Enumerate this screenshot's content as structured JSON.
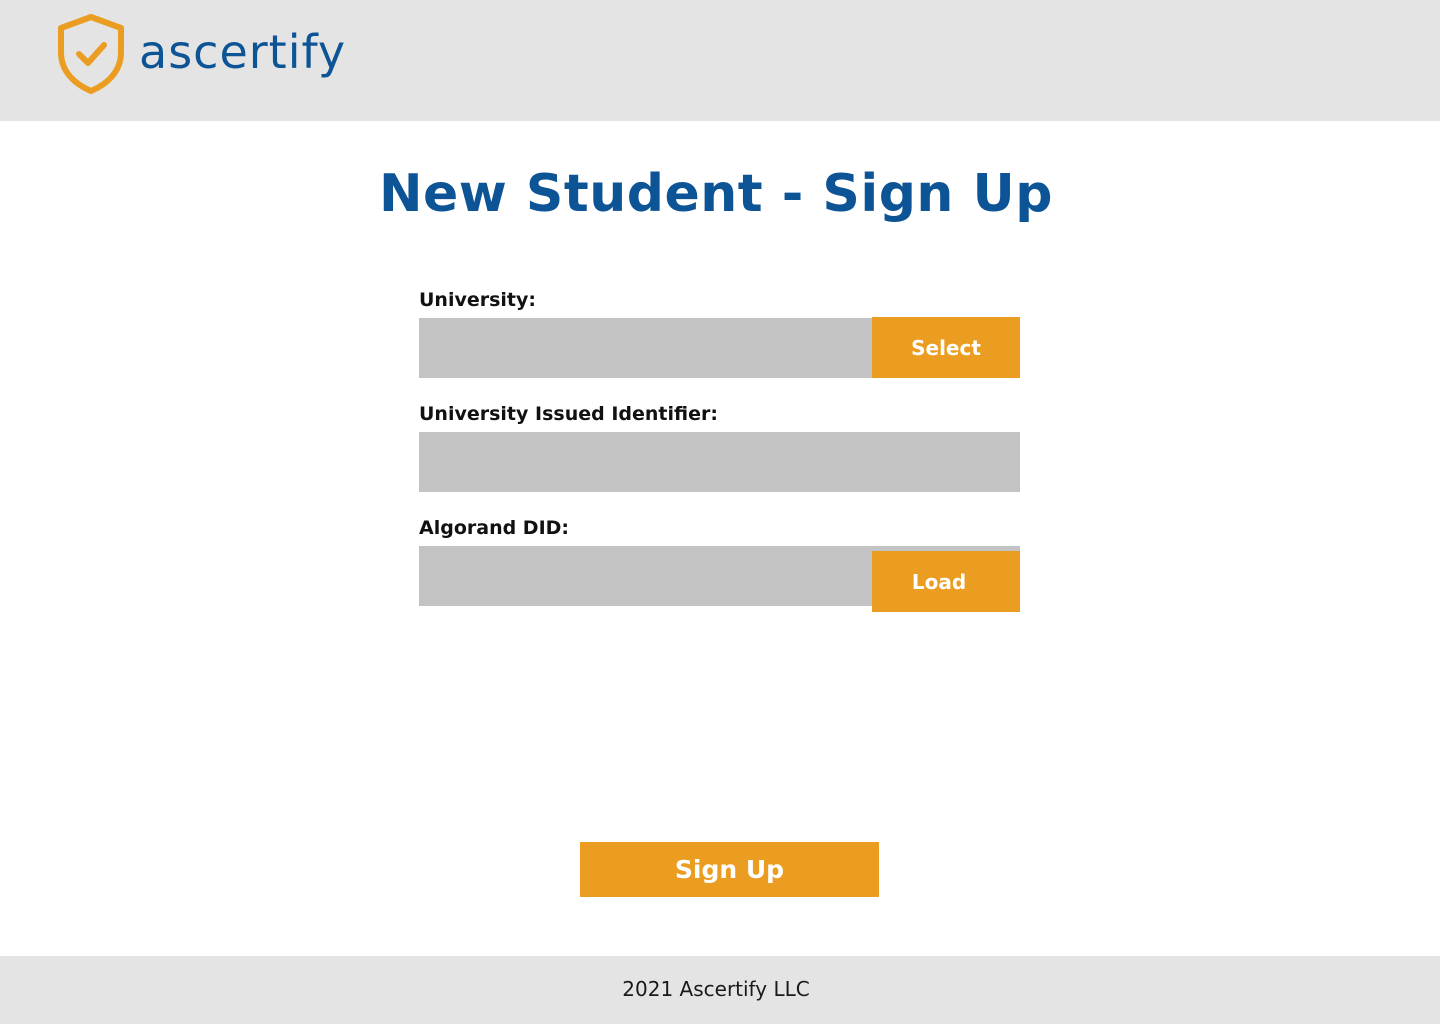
{
  "header": {
    "logo_text": "ascertify",
    "logo_icon": "shield-check-icon",
    "colors": {
      "shield": "#eb9d22",
      "wordmark": "#0c5496",
      "background": "#e4e4e4"
    }
  },
  "main": {
    "title": "New Student - Sign Up",
    "fields": {
      "university": {
        "label": "University:",
        "value": "",
        "button_label": "Select"
      },
      "identifier": {
        "label": "University Issued Identifier:",
        "value": ""
      },
      "did": {
        "label": "Algorand DID:",
        "value": "",
        "button_label": "Load"
      }
    },
    "submit_label": "Sign Up"
  },
  "footer": {
    "text": "2021 Ascertify LLC"
  },
  "colors": {
    "accent": "#eb9d22",
    "title": "#0c5496",
    "input_bg": "#c3c3c3"
  }
}
